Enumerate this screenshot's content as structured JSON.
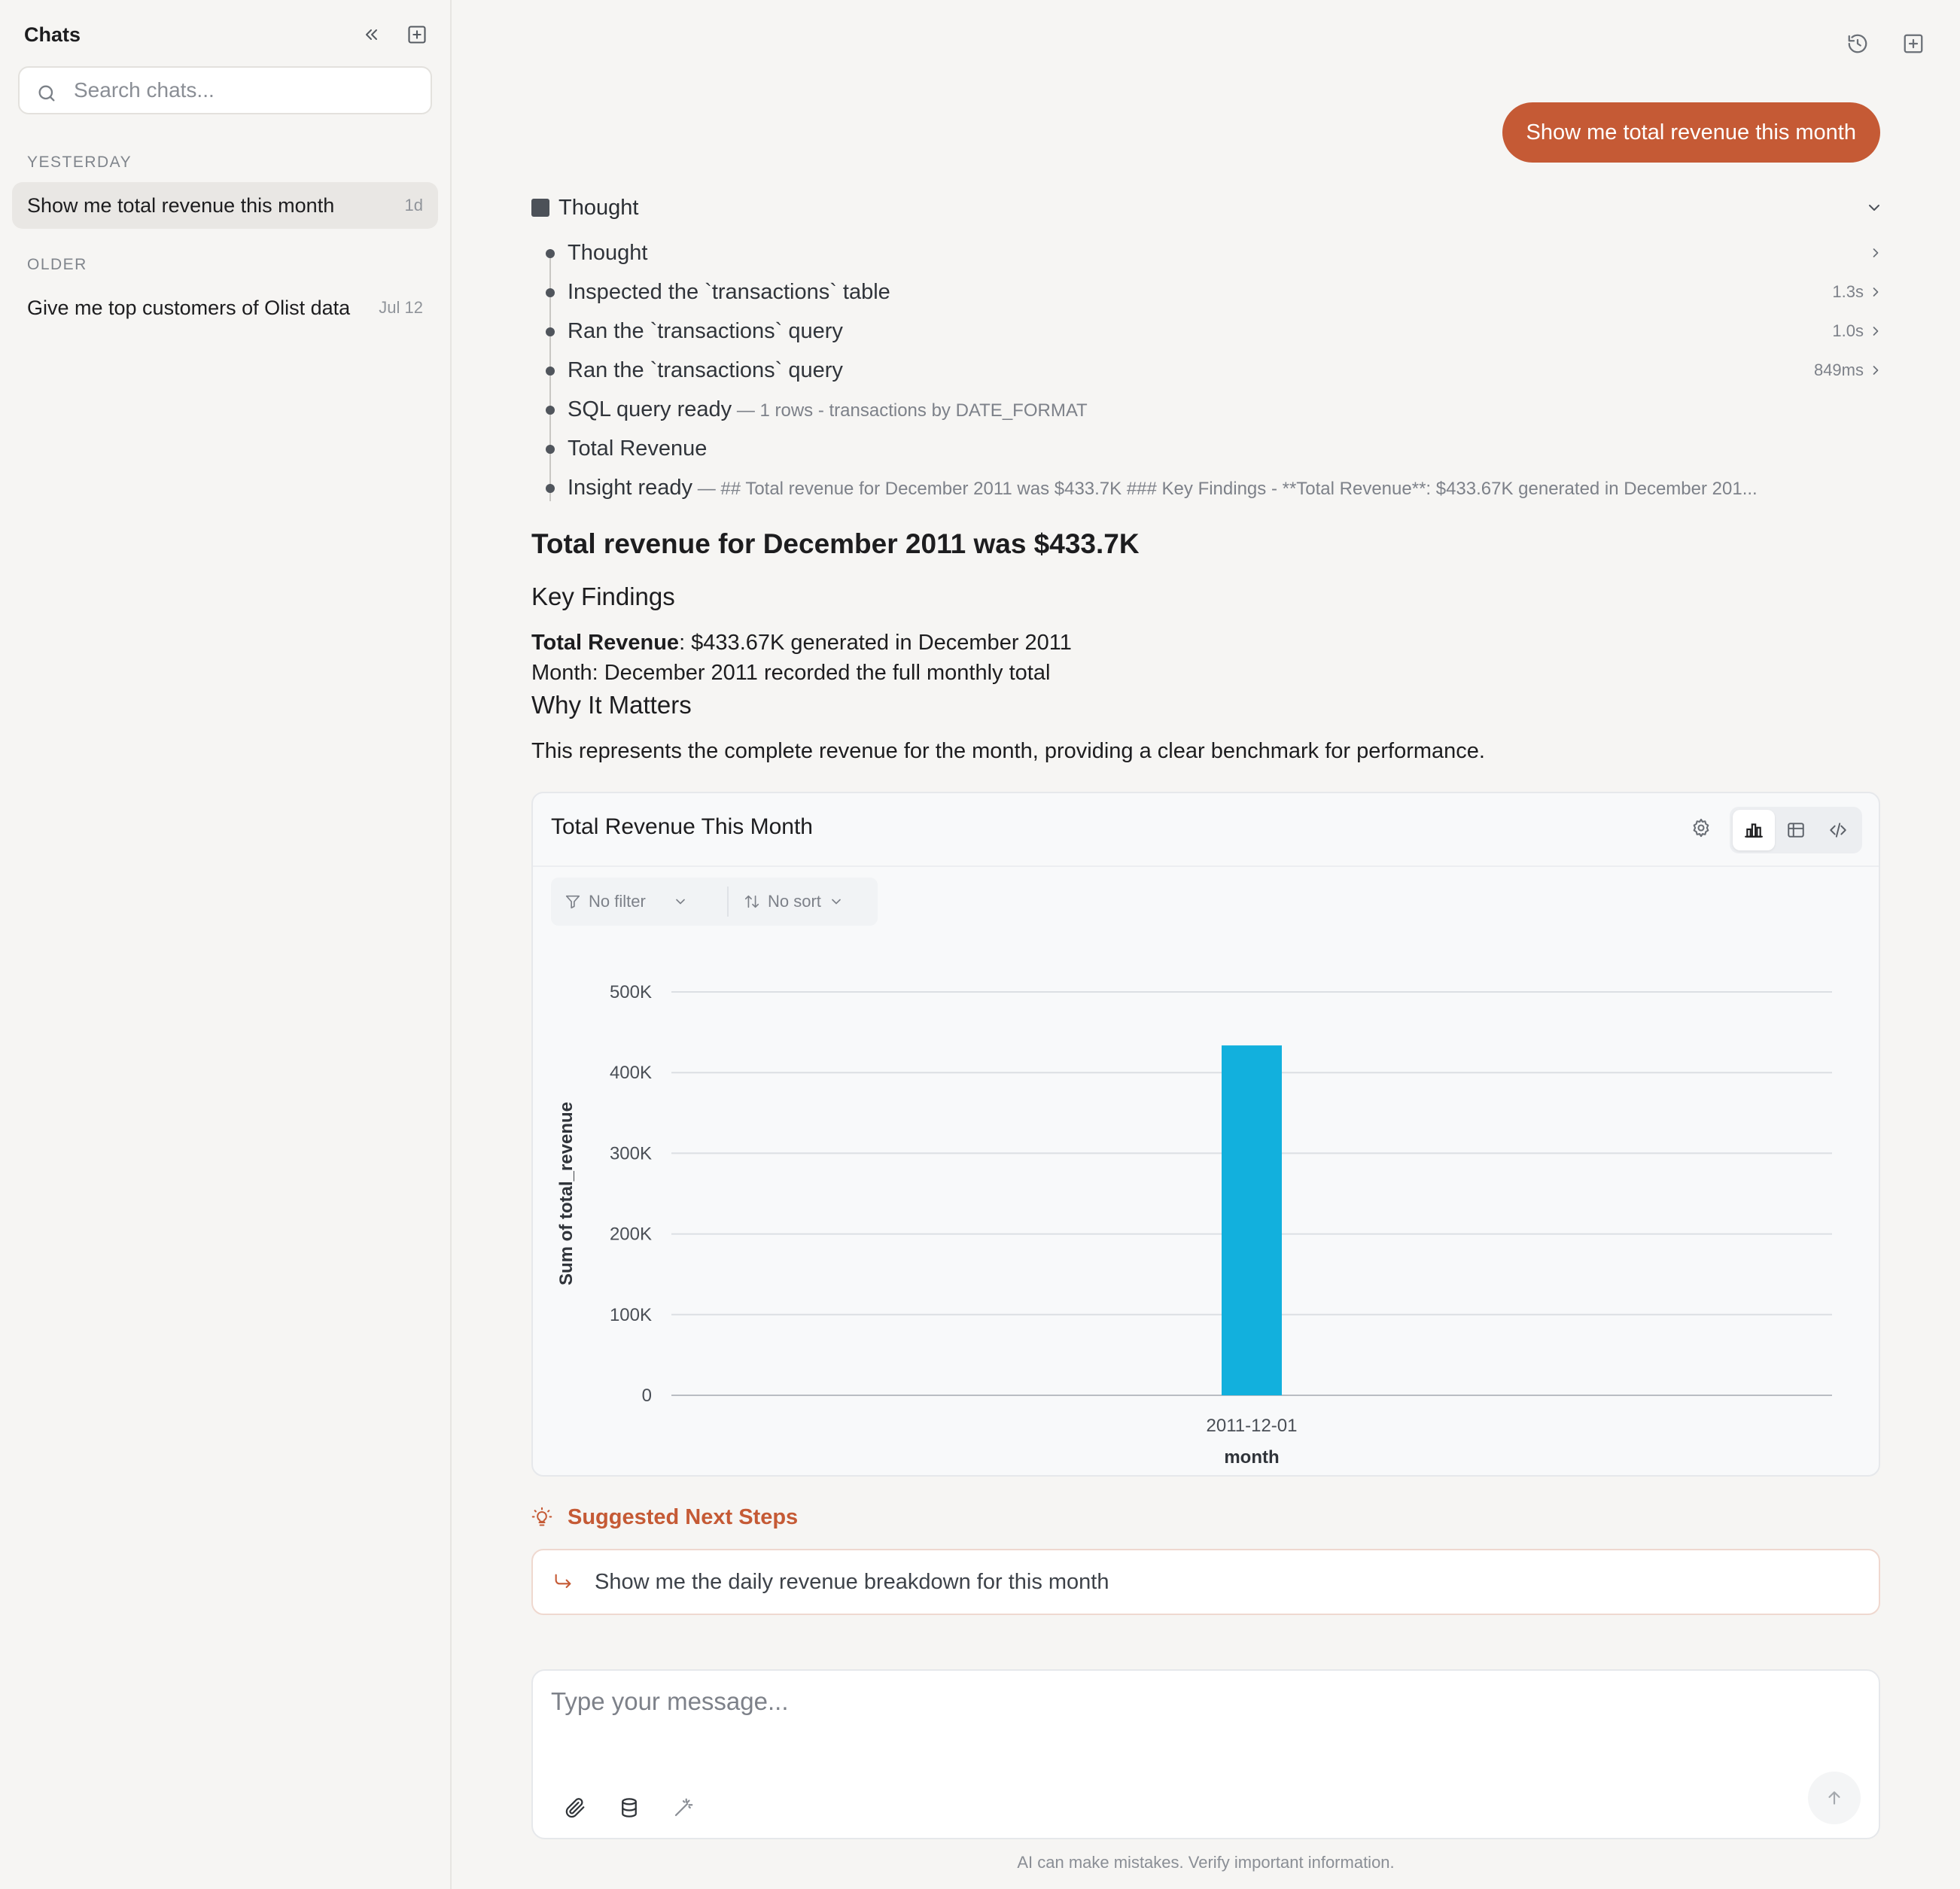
{
  "sidebar": {
    "title": "Chats",
    "search_placeholder": "Search chats...",
    "sections": [
      {
        "label": "YESTERDAY",
        "items": [
          {
            "label": "Show me total revenue this month",
            "time": "1d"
          }
        ]
      },
      {
        "label": "OLDER",
        "items": [
          {
            "label": "Give me top customers of Olist data",
            "time": "Jul 12"
          }
        ]
      }
    ]
  },
  "conversation": {
    "user_message": "Show me total revenue this month",
    "thought": {
      "title": "Thought",
      "steps": [
        {
          "label": "Thought",
          "sub": "",
          "duration": ""
        },
        {
          "label": "Inspected the `transactions` table",
          "sub": "",
          "duration": "1.3s"
        },
        {
          "label": "Ran the `transactions` query",
          "sub": "",
          "duration": "1.0s"
        },
        {
          "label": "Ran the `transactions` query",
          "sub": "",
          "duration": "849ms"
        },
        {
          "label": "SQL query ready",
          "sub": " — 1 rows - transactions by DATE_FORMAT",
          "duration": ""
        },
        {
          "label": "Total Revenue",
          "sub": "",
          "duration": ""
        },
        {
          "label": "Insight ready",
          "sub": " — ## Total revenue for December 2011 was $433.7K ### Key Findings - **Total Revenue**: $433.67K generated in December 201...",
          "duration": ""
        }
      ]
    },
    "answer": {
      "heading": "Total revenue for December 2011 was $433.7K",
      "key_findings_heading": "Key Findings",
      "finding_1_bold": "Total Revenue",
      "finding_1_rest": ": $433.67K generated in December 2011",
      "finding_2": "Month: December 2011 recorded the full monthly total",
      "why_heading": "Why It Matters",
      "why_text": "This represents the complete revenue for the month, providing a clear benchmark for performance."
    },
    "chart_card": {
      "title": "Total Revenue This Month",
      "filter_label": "No filter",
      "sort_label": "No sort"
    },
    "suggested": {
      "title": "Suggested Next Steps",
      "items": [
        "Show me the daily revenue breakdown for this month"
      ]
    }
  },
  "composer": {
    "placeholder": "Type your message...",
    "disclaimer": "AI can make mistakes. Verify important information."
  },
  "colors": {
    "accent": "#c55a35",
    "bar": "#12b0dd"
  },
  "chart_data": {
    "type": "bar",
    "title": "Total Revenue This Month",
    "categories": [
      "2011-12-01"
    ],
    "series": [
      {
        "name": "Sum of total_revenue",
        "values": [
          433670
        ]
      }
    ],
    "xlabel": "month",
    "ylabel": "Sum of total_revenue",
    "ylim": [
      0,
      500000
    ],
    "yticks": [
      "0",
      "100K",
      "200K",
      "300K",
      "400K",
      "500K"
    ],
    "grid": true,
    "legend": "bottom"
  }
}
